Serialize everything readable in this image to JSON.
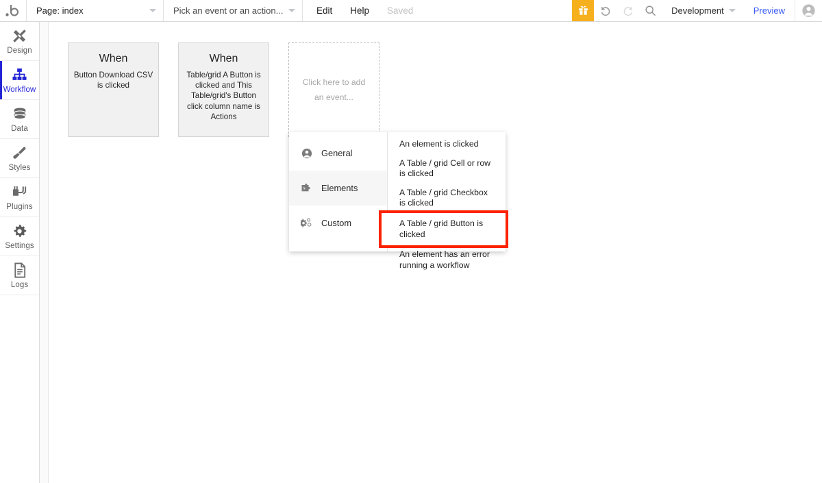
{
  "topbar": {
    "logo_icon": "bubble-logo-icon",
    "page_selector": {
      "label": "Page: index",
      "caret_icon": "chevron-down-icon"
    },
    "event_selector": {
      "label": "Pick an event or an action...",
      "caret_icon": "chevron-down-icon"
    },
    "menu": [
      {
        "label": "Edit",
        "state": "normal"
      },
      {
        "label": "Help",
        "state": "normal"
      },
      {
        "label": "Saved",
        "state": "muted"
      }
    ],
    "gift_icon": "gift-icon",
    "gift_bg": "#f6b01e",
    "undo_icon": "undo-icon",
    "redo_icon": "redo-icon",
    "search_icon": "search-icon",
    "version": {
      "label": "Development",
      "caret_icon": "chevron-down-icon"
    },
    "preview": {
      "label": "Preview",
      "color": "#3b5bf5"
    },
    "avatar_icon": "user-avatar-icon"
  },
  "sidebar": {
    "items": [
      {
        "label": "Design",
        "icon": "design-tools-icon",
        "active": false
      },
      {
        "label": "Workflow",
        "icon": "workflow-tree-icon",
        "active": true
      },
      {
        "label": "Data",
        "icon": "database-icon",
        "active": false
      },
      {
        "label": "Styles",
        "icon": "paintbrush-icon",
        "active": false
      },
      {
        "label": "Plugins",
        "icon": "plug-icon",
        "active": false
      },
      {
        "label": "Settings",
        "icon": "gear-icon",
        "active": false
      },
      {
        "label": "Logs",
        "icon": "document-lines-icon",
        "active": false
      }
    ],
    "active_color": "#2323d6",
    "collapse_handle_icon": "triangle-right-icon"
  },
  "canvas": {
    "workflow_cards": [
      {
        "when": "When",
        "description": "Button Download CSV is clicked"
      },
      {
        "when": "When",
        "description": "Table/grid A Button is clicked and This Table/grid's Button click column name is Actions"
      }
    ],
    "placeholder": {
      "text": "Click here to add an event..."
    }
  },
  "dropdown": {
    "categories": [
      {
        "label": "General",
        "icon": "user-circle-icon",
        "active": false
      },
      {
        "label": "Elements",
        "icon": "puzzle-piece-icon",
        "active": true
      },
      {
        "label": "Custom",
        "icon": "gears-icon",
        "active": false
      }
    ],
    "options": [
      {
        "label": "An element is clicked",
        "highlighted": false
      },
      {
        "label": "A Table / grid Cell or row is clicked",
        "highlighted": false
      },
      {
        "label": "A Table / grid Checkbox is clicked",
        "highlighted": false
      },
      {
        "label": "A Table / grid Button is clicked",
        "highlighted": true
      },
      {
        "label": "An element has an error running a workflow",
        "highlighted": false
      }
    ],
    "highlight_color": "#fb2300"
  }
}
